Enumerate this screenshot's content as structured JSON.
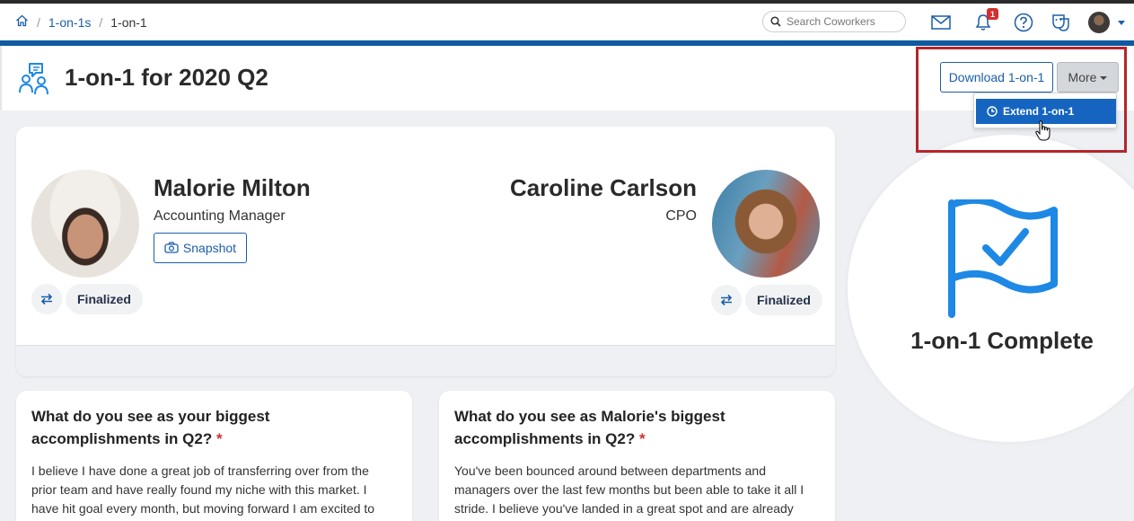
{
  "breadcrumb": {
    "parent": "1-on-1s",
    "current": "1-on-1"
  },
  "search": {
    "placeholder": "Search Coworkers"
  },
  "notifications": {
    "count": "1"
  },
  "page": {
    "title": "1-on-1 for 2020 Q2"
  },
  "actions": {
    "download_label": "Download 1-on-1",
    "more_label": "More",
    "dropdown_items": [
      {
        "label": "Extend 1-on-1"
      }
    ]
  },
  "participants": [
    {
      "name": "Malorie Milton",
      "role": "Accounting Manager",
      "snapshot_label": "Snapshot",
      "status": "Finalized"
    },
    {
      "name": "Caroline Carlson",
      "role": "CPO",
      "status": "Finalized"
    }
  ],
  "completion": {
    "label": "1-on-1 Complete"
  },
  "questions": [
    {
      "title": "What do you see as your biggest accomplishments in Q2?",
      "required_mark": "*",
      "answer": "I believe I have done a great job of transferring over from the prior team and have really found my niche with this market. I have hit goal every month, but moving forward I am excited to push my"
    },
    {
      "title": "What do you see as Malorie's biggest accomplishments in Q2?",
      "required_mark": "*",
      "answer": "You've been bounced around between departments and managers over the last few months but been able to take it all I stride. I believe you've landed in a great spot and are already"
    }
  ],
  "colors": {
    "brand_blue": "#0f5aa0",
    "link_blue": "#1a5ea8",
    "highlight_red": "#b3262c",
    "complete_blue": "#1e88e5"
  }
}
